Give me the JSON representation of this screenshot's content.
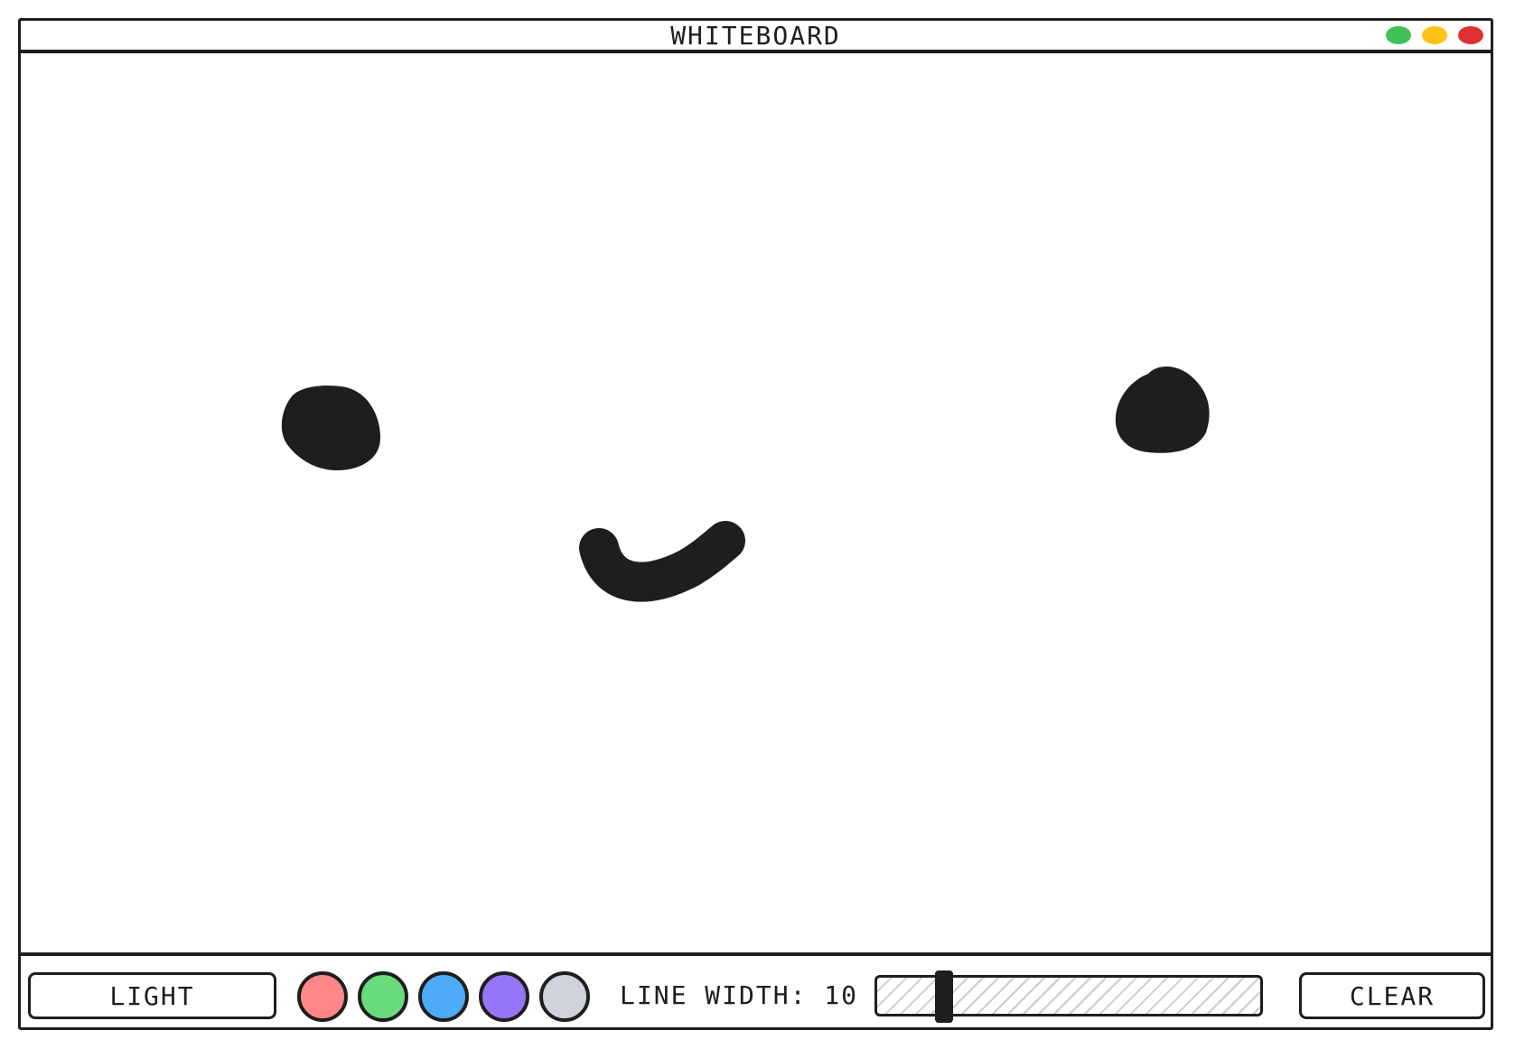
{
  "window": {
    "title": "WHITEBOARD",
    "controls": {
      "green": "#40c057",
      "yellow": "#fcc419",
      "red": "#e03131"
    }
  },
  "canvas": {
    "background": "#ffffff",
    "stroke_color": "#1e1e1e",
    "drawing": "smiley face"
  },
  "toolbar": {
    "theme_button_label": "LIGHT",
    "swatches": [
      {
        "name": "red",
        "color": "#ff8787"
      },
      {
        "name": "green",
        "color": "#69db7c"
      },
      {
        "name": "blue",
        "color": "#4dabf7"
      },
      {
        "name": "purple",
        "color": "#9775fa"
      },
      {
        "name": "gray",
        "color": "#ced4da"
      }
    ],
    "line_width_label": "LINE WIDTH: 10",
    "line_width_value": 10,
    "line_width_min": 1,
    "line_width_max": 100,
    "clear_button_label": "CLEAR"
  }
}
